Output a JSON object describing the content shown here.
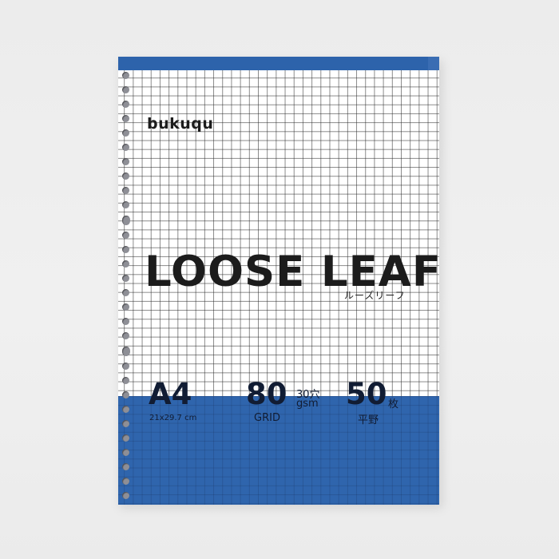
{
  "product": {
    "brand": "bukuqu",
    "title": "LOOSE LEAF",
    "title_sub": "ルーズリーフ",
    "size": "A4",
    "size_dims": "21x29.7 cm",
    "weight": "80",
    "weight_unit": "gsm",
    "holes": "30穴",
    "ruling": "GRID",
    "sheets": "50",
    "sheets_unit": "枚",
    "binding": "平野"
  },
  "colors": {
    "cover_blue": "#2f65ad",
    "text_dark": "#1c1c1c",
    "background": "#efefef"
  }
}
